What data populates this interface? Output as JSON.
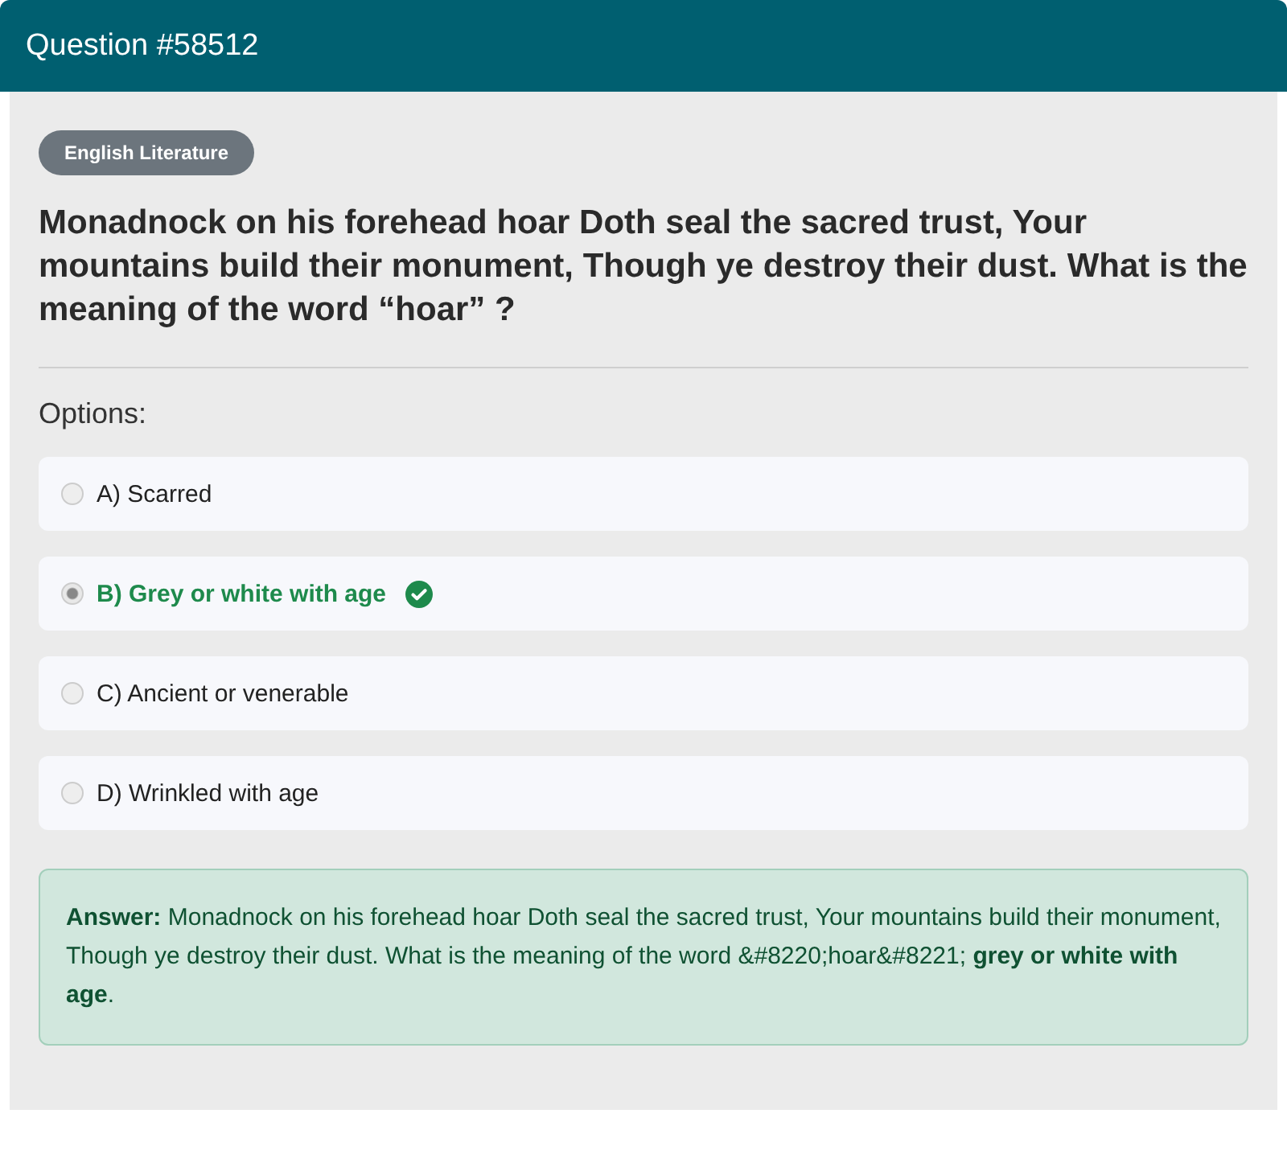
{
  "header": {
    "title": "Question #58512"
  },
  "category": "English Literature",
  "question": "Monadnock on his forehead hoar Doth seal the sacred trust, Your mountains build their monument, Though ye destroy their dust. What is the meaning of the word “hoar” ?",
  "options_label": "Options:",
  "options": [
    {
      "label": "A) Scarred",
      "selected": false,
      "correct": false
    },
    {
      "label": "B) Grey or white with age",
      "selected": true,
      "correct": true
    },
    {
      "label": "C) Ancient or venerable",
      "selected": false,
      "correct": false
    },
    {
      "label": "D) Wrinkled with age",
      "selected": false,
      "correct": false
    }
  ],
  "answer": "**Answer:** Monadnock on his forehead hoar Doth seal the sacred trust, Your mountains build their monument, Though ye destroy their dust. What is the meaning of the word &#8220;hoar&#8221; **grey or white with age**."
}
